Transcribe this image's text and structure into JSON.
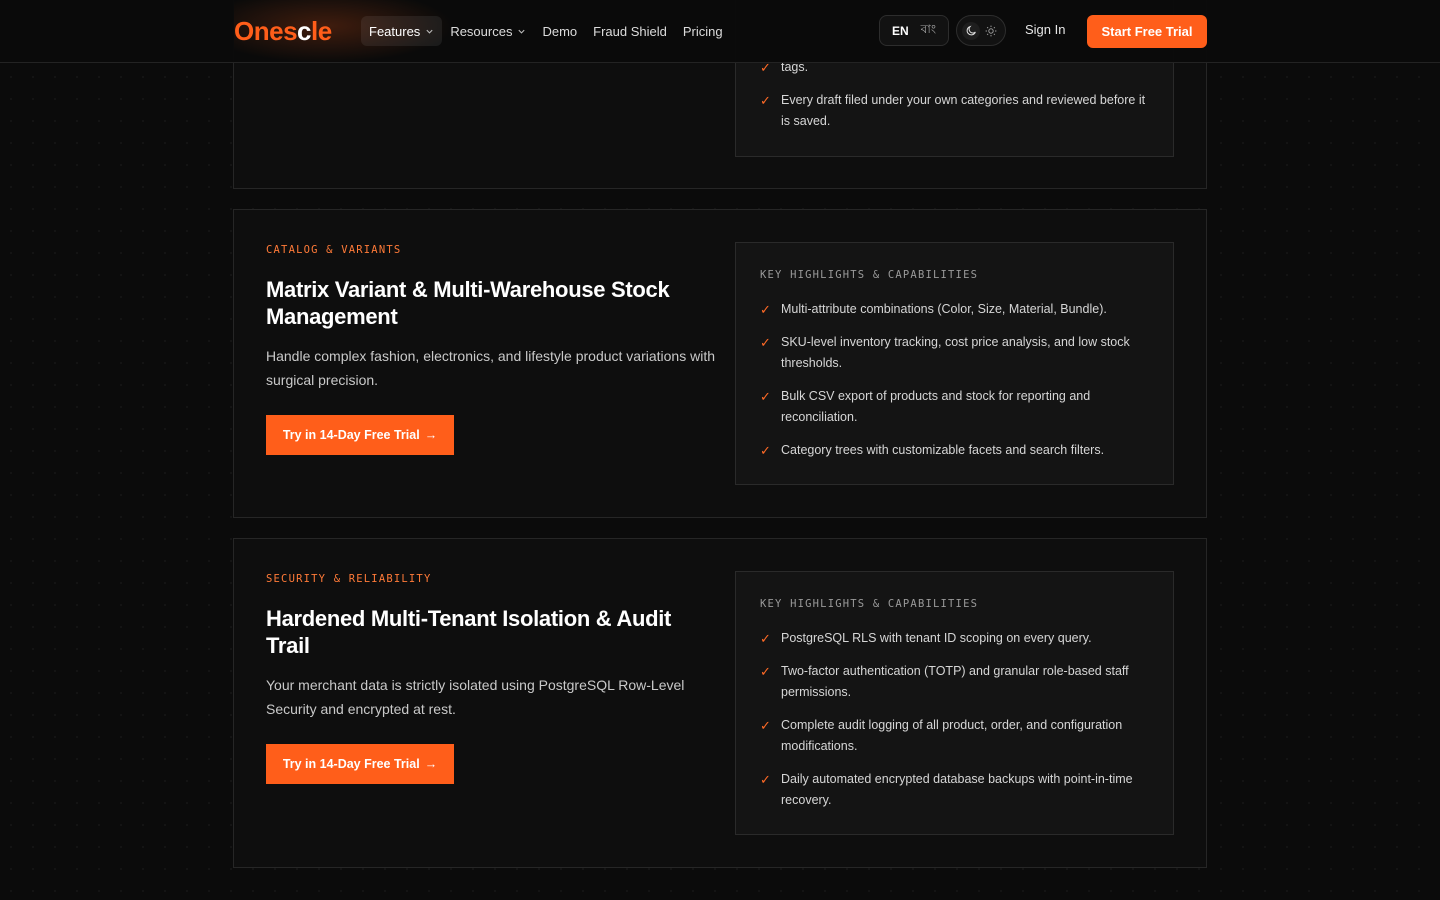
{
  "nav": {
    "logo_prefix": "O",
    "logo_mid": "nes",
    "logo_c": "c",
    "logo_suffix": "le",
    "links": [
      {
        "label": "Features",
        "dropdown": true
      },
      {
        "label": "Resources",
        "dropdown": true
      },
      {
        "label": "Demo",
        "dropdown": false
      },
      {
        "label": "Fraud Shield",
        "dropdown": false
      },
      {
        "label": "Pricing",
        "dropdown": false
      }
    ],
    "lang_en": "EN",
    "lang_bn": "বাং",
    "theme_dark_icon": "moon-icon",
    "theme_light_icon": "sun-icon",
    "sign_in": "Sign In",
    "cta": "Start Free Trial"
  },
  "colors": {
    "accent": "#ff5e1a",
    "background": "#0b0b0b",
    "card": "#0e0e0e"
  },
  "card_top": {
    "highlights": [
      "tags.",
      "Every draft filed under your own categories and reviewed before it is saved."
    ]
  },
  "card_catalog": {
    "kicker": "CATALOG & VARIANTS",
    "title": "Matrix Variant & Multi-Warehouse Stock Management",
    "description": "Handle complex fashion, electronics, and lifestyle product variations with surgical precision.",
    "button": "Try in 14-Day Free Trial",
    "button_arrow": "→",
    "highlights_heading": "KEY HIGHLIGHTS & CAPABILITIES",
    "highlights": [
      "Multi-attribute combinations (Color, Size, Material, Bundle).",
      "SKU-level inventory tracking, cost price analysis, and low stock thresholds.",
      "Bulk CSV export of products and stock for reporting and reconciliation.",
      "Category trees with customizable facets and search filters."
    ]
  },
  "card_security": {
    "kicker": "SECURITY & RELIABILITY",
    "title": "Hardened Multi-Tenant Isolation & Audit Trail",
    "description": "Your merchant data is strictly isolated using PostgreSQL Row-Level Security and encrypted at rest.",
    "button": "Try in 14-Day Free Trial",
    "button_arrow": "→",
    "highlights_heading": "KEY HIGHLIGHTS & CAPABILITIES",
    "highlights": [
      "PostgreSQL RLS with tenant ID scoping on every query.",
      "Two-factor authentication (TOTP) and granular role-based staff permissions.",
      "Complete audit logging of all product, order, and configuration modifications.",
      "Daily automated encrypted database backups with point-in-time recovery."
    ]
  }
}
